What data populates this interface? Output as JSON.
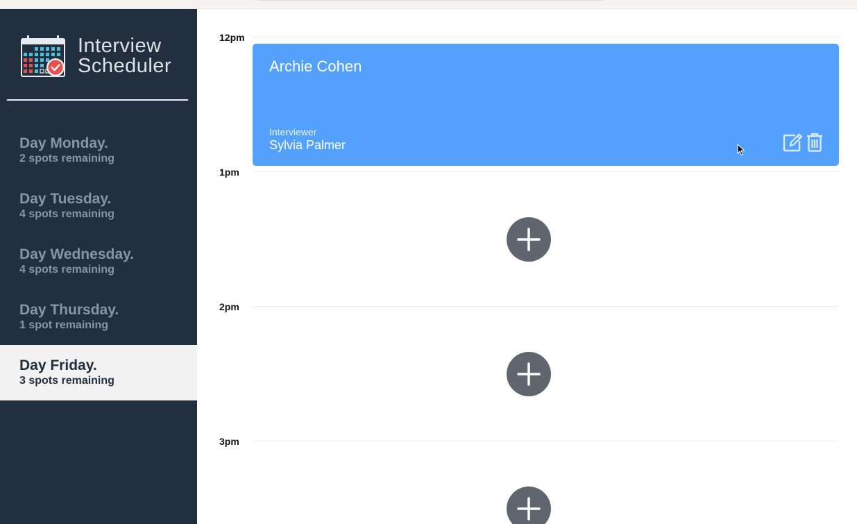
{
  "app": {
    "title_line1": "Interview",
    "title_line2": "Scheduler"
  },
  "days": [
    {
      "name": "Day Monday.",
      "spots": "2 spots remaining",
      "selected": false
    },
    {
      "name": "Day Tuesday.",
      "spots": "4 spots remaining",
      "selected": false
    },
    {
      "name": "Day Wednesday.",
      "spots": "4 spots remaining",
      "selected": false
    },
    {
      "name": "Day Thursday.",
      "spots": "1 spot remaining",
      "selected": false
    },
    {
      "name": "Day Friday.",
      "spots": "3 spots remaining",
      "selected": true
    }
  ],
  "schedule": {
    "times": [
      "12pm",
      "1pm",
      "2pm",
      "3pm"
    ],
    "appointment": {
      "student": "Archie Cohen",
      "interviewer_label": "Interviewer",
      "interviewer": "Sylvia Palmer"
    }
  },
  "icons": {
    "logo": "calendar-check-icon",
    "edit": "edit-icon",
    "delete": "trash-icon",
    "add": "plus-icon"
  },
  "colors": {
    "sidebar": "#222f3e",
    "appointment": "#53a1fc",
    "add_button": "#5f6670",
    "selected_day": "#f2f2f2"
  }
}
